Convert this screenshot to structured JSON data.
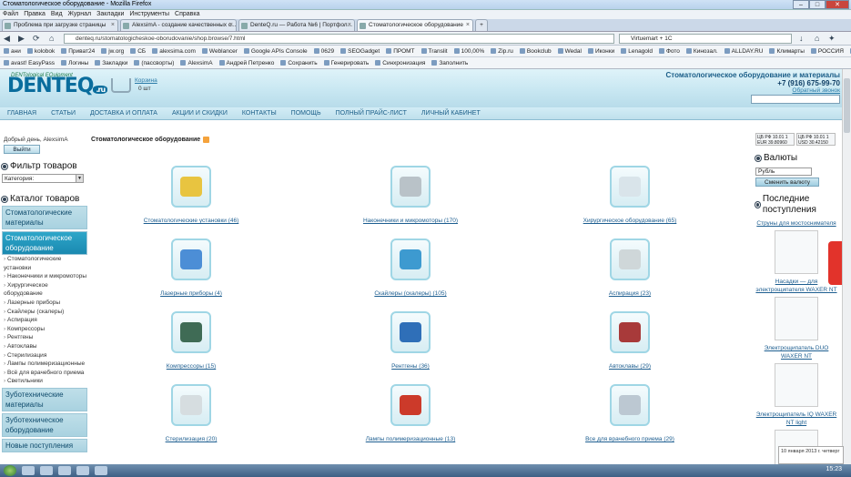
{
  "window": {
    "title": "Стоматологическое оборудование - Mozilla Firefox"
  },
  "menu": [
    "Файл",
    "Правка",
    "Вид",
    "Журнал",
    "Закладки",
    "Инструменты",
    "Справка"
  ],
  "tabs": [
    {
      "label": "Проблема при загрузке страницы"
    },
    {
      "label": "AlexsimA - создание качественных с..."
    },
    {
      "label": "DenteQ.ru — Работа №6 | Портфол..."
    },
    {
      "label": "Стоматологическое оборудование"
    }
  ],
  "url": "denteq.ru/stomatologicheskoe-oborudovanie/shop.browse/7.html",
  "search_engine": "Virtuemart + 1С",
  "bookmarks1": [
    "ани",
    "kolobok",
    "Приват24",
    "jw.org",
    "СБ",
    "alexsima.com",
    "Weblancer",
    "Google APIs Console",
    "0629",
    "SEOGadget",
    "ПРОМТ",
    "Translit",
    "100,00%",
    "Zip.ru",
    "Bookclub",
    "Wedal",
    "Иконки",
    "Lenagold",
    "Фото",
    "Кинозал.",
    "ALLDAY.RU",
    "Климарты",
    "РОССИЯ",
    "Granata",
    "Fotomag"
  ],
  "bookmarks2": [
    "avast! EasyPass",
    "Логины",
    "Закладки",
    "(пассворты)",
    "AlexsimA",
    "Андрей Петренко",
    "Сохранить",
    "Генерировать",
    "Синхронизация",
    "Заполнить"
  ],
  "site": {
    "logo_text": "DENTEQ",
    "logo_ru": ".ru",
    "logo_sub": "DENTological EQuipment",
    "cart_label": "Корзина",
    "cart_count": "0 шт",
    "header_title": "Стоматологическое оборудование и материалы",
    "phone": "+7 (916) 675-99-70",
    "callback": "Обратный звонок",
    "nav": [
      "Главная",
      "Статьи",
      "Доставка и оплата",
      "Акции и скидки",
      "Контакты",
      "Помощь",
      "Полный прайс-лист",
      "Личный кабинет"
    ]
  },
  "left": {
    "greeting": "Добрый день, AlexsimA",
    "exit_btn": "Выйти",
    "filter_title": "Фильтр товаров",
    "category_select": "Категория:",
    "catalog_title": "Каталог товаров",
    "cats": [
      {
        "label": "Стоматологические материалы"
      },
      {
        "label": "Стоматологическое оборудование"
      }
    ],
    "subitems": [
      "Стоматологические установки",
      "Наконечники и микромоторы",
      "Хирургическое оборудование",
      "Лазерные приборы",
      "Скайлеры (скалеры)",
      "Аспирация",
      "Компрессоры",
      "Рентгены",
      "Автоклавы",
      "Стерилизация",
      "Лампы полимеризационные",
      "Всё для врачебного приема",
      "Светильники"
    ],
    "cats2": [
      {
        "label": "Зуботехнические материалы"
      },
      {
        "label": "Зуботехническое оборудование"
      },
      {
        "label": "Новые поступления"
      }
    ]
  },
  "main": {
    "title": "Стоматологическое оборудование",
    "products": [
      {
        "label": "Стоматологические установки (46)",
        "color": "#e8c440"
      },
      {
        "label": "Наконечники и микромоторы (170)",
        "color": "#b9c2c8"
      },
      {
        "label": "Хирургическое оборудование (65)",
        "color": "#d9e4ea"
      },
      {
        "label": "Лазерные приборы (4)",
        "color": "#4c8ed6"
      },
      {
        "label": "Скайлеры (скалеры) (105)",
        "color": "#3d9ad0"
      },
      {
        "label": "Аспирация (23)",
        "color": "#cfd7d9"
      },
      {
        "label": "Компрессоры (15)",
        "color": "#3f6b55"
      },
      {
        "label": "Рентгены (36)",
        "color": "#2f6fb8"
      },
      {
        "label": "Автоклавы (29)",
        "color": "#a83a3a"
      },
      {
        "label": "Стерилизация (20)",
        "color": "#d6dde0"
      },
      {
        "label": "Лампы полимеризационные (13)",
        "color": "#cc3a2a"
      },
      {
        "label": "Все для врачебного приема (29)",
        "color": "#bcc8d2"
      }
    ]
  },
  "right": {
    "cur1": "ЦБ РФ 10.01  1 EUR 39.80960",
    "cur2": "ЦБ РФ 10.01  1 USD 30.42150",
    "currency_title": "Валюты",
    "currency_select": "Рубль",
    "change_btn": "Сменить валюту",
    "new_title": "Последние поступления",
    "items": [
      "Струны для мостоснимателя",
      "Насадки — для электрощипателя WAXER NT",
      "Электрощипатель DUO WAXER NT",
      "Электрощипатель IQ WAXER NT light"
    ]
  },
  "taskbar": {
    "time": "15:23",
    "notif": "10 января 2013 г. четверг"
  }
}
